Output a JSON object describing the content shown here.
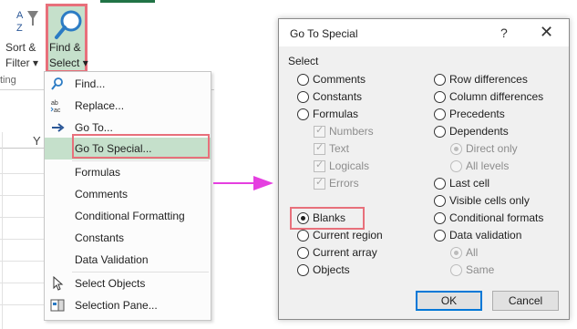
{
  "ribbon": {
    "sort_label": "Sort &",
    "filter_label": "Filter",
    "find_label": "Find &",
    "select_label": "Select",
    "group_label": "ting",
    "column_header": "Y"
  },
  "menu": {
    "items": [
      {
        "label": "Find...",
        "icon": "magnifier-icon"
      },
      {
        "label": "Replace...",
        "icon": "replace-icon"
      },
      {
        "label": "Go To...",
        "icon": "arrow-right-icon"
      },
      {
        "label": "Go To Special..."
      },
      {
        "label": "Formulas"
      },
      {
        "label": "Comments"
      },
      {
        "label": "Conditional Formatting"
      },
      {
        "label": "Constants"
      },
      {
        "label": "Data Validation"
      },
      {
        "label": "Select Objects",
        "icon": "pointer-icon"
      },
      {
        "label": "Selection Pane...",
        "icon": "selection-pane-icon"
      }
    ],
    "highlighted_index": 3
  },
  "dialog": {
    "title": "Go To Special",
    "help": "?",
    "close": "✕",
    "group_label": "Select",
    "left_options": [
      {
        "label": "Comments",
        "checked": false
      },
      {
        "label": "Constants",
        "checked": false
      },
      {
        "label": "Formulas",
        "checked": false
      },
      {
        "label": "Numbers",
        "sub": true,
        "checkbox": true
      },
      {
        "label": "Text",
        "sub": true,
        "checkbox": true
      },
      {
        "label": "Logicals",
        "sub": true,
        "checkbox": true
      },
      {
        "label": "Errors",
        "sub": true,
        "checkbox": true
      },
      {
        "label": "Blanks",
        "checked": true
      },
      {
        "label": "Current region",
        "checked": false
      },
      {
        "label": "Current array",
        "checked": false
      },
      {
        "label": "Objects",
        "checked": false
      }
    ],
    "right_options": [
      {
        "label": "Row differences",
        "checked": false
      },
      {
        "label": "Column differences",
        "checked": false
      },
      {
        "label": "Precedents",
        "checked": false
      },
      {
        "label": "Dependents",
        "checked": false
      },
      {
        "label": "Direct only",
        "sub": true,
        "checked": true
      },
      {
        "label": "All levels",
        "sub": true,
        "checked": false
      },
      {
        "label": "Last cell",
        "checked": false
      },
      {
        "label": "Visible cells only",
        "checked": false
      },
      {
        "label": "Conditional formats",
        "checked": false
      },
      {
        "label": "Data validation",
        "checked": false
      },
      {
        "label": "All",
        "sub": true,
        "checked": true
      },
      {
        "label": "Same",
        "sub": true,
        "checked": false
      }
    ],
    "ok_label": "OK",
    "cancel_label": "Cancel"
  },
  "colors": {
    "accent_green": "#217346",
    "highlight_green": "#c5e0cb",
    "callout_red": "#e8707b",
    "arrow_magenta": "#e53fe0"
  }
}
